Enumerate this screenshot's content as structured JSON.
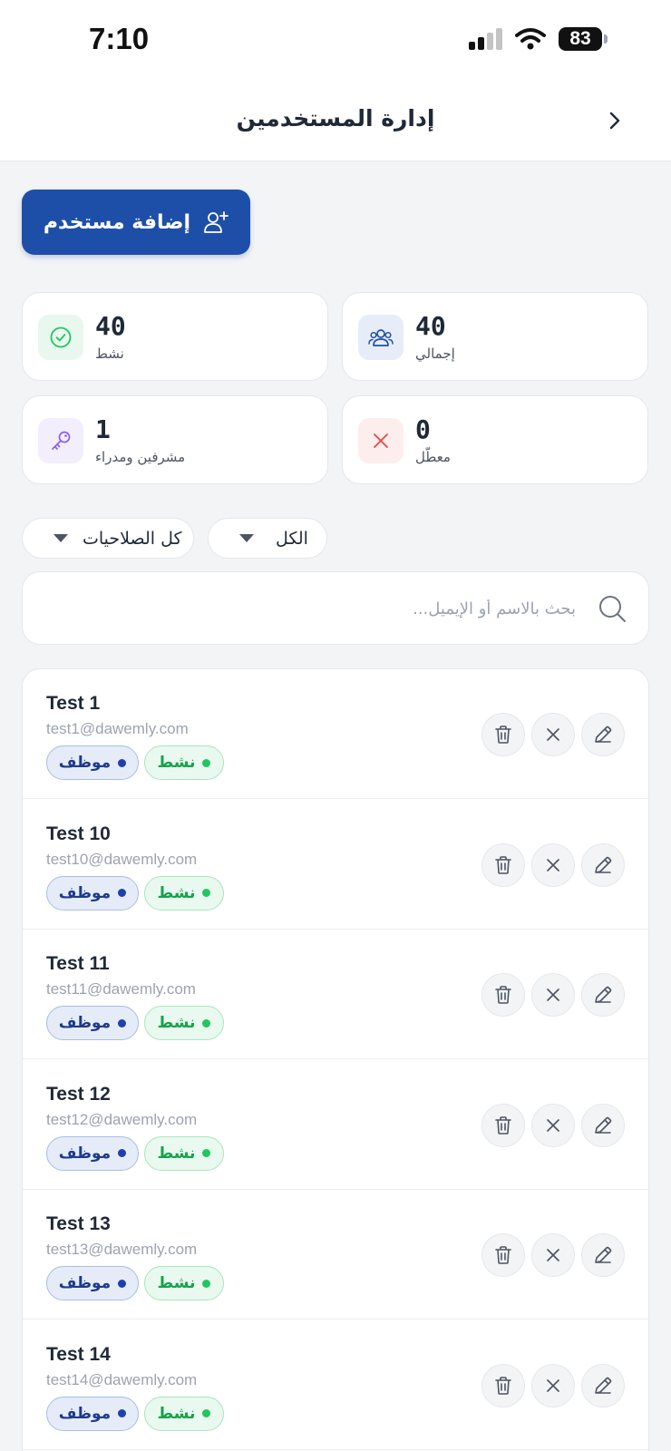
{
  "status_bar": {
    "time": "7:10",
    "battery": "83"
  },
  "header": {
    "title": "إدارة المستخدمين"
  },
  "add_button": {
    "label": "إضافة مستخدم"
  },
  "stats": {
    "total": {
      "value": "40",
      "label": "إجمالي"
    },
    "active": {
      "value": "40",
      "label": "نشط"
    },
    "disabled": {
      "value": "0",
      "label": "معطّل"
    },
    "admins": {
      "value": "1",
      "label": "مشرفين ومدراء"
    }
  },
  "filters": {
    "status": {
      "selected": "الكل"
    },
    "role": {
      "selected": "كل الصلاحيات"
    }
  },
  "search": {
    "placeholder": "بحث بالاسم أو الإيميل..."
  },
  "users": [
    {
      "name": "Test 1",
      "email": "test1@dawemly.com",
      "role": "موظف",
      "status": "نشط"
    },
    {
      "name": "Test 10",
      "email": "test10@dawemly.com",
      "role": "موظف",
      "status": "نشط"
    },
    {
      "name": "Test 11",
      "email": "test11@dawemly.com",
      "role": "موظف",
      "status": "نشط"
    },
    {
      "name": "Test 12",
      "email": "test12@dawemly.com",
      "role": "موظف",
      "status": "نشط"
    },
    {
      "name": "Test 13",
      "email": "test13@dawemly.com",
      "role": "موظف",
      "status": "نشط"
    },
    {
      "name": "Test 14",
      "email": "test14@dawemly.com",
      "role": "موظف",
      "status": "نشط"
    }
  ],
  "colors": {
    "primary": "#1e4fa8",
    "active_green": "#22c55e",
    "danger_red": "#ef4444",
    "admin_purple": "#8b5cf6"
  },
  "icons": {
    "back": "chevron-right-icon",
    "add_user": "user-plus-icon",
    "total": "users-icon",
    "active": "check-circle-icon",
    "disabled": "x-icon",
    "admins": "key-icon",
    "search": "search-icon",
    "delete": "trash-icon",
    "disable": "x-icon",
    "edit": "pencil-icon"
  }
}
